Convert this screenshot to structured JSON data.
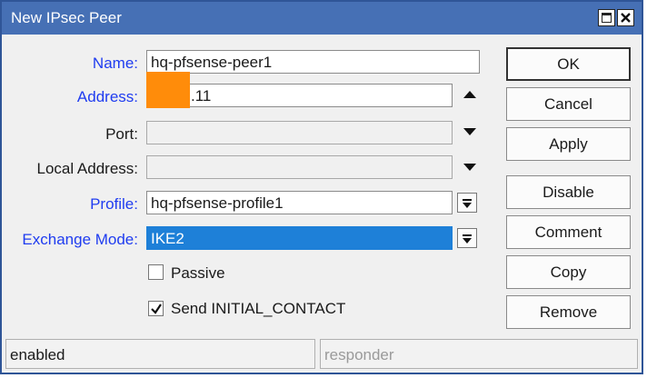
{
  "window": {
    "title": "New IPsec Peer"
  },
  "form": {
    "name": {
      "label": "Name:",
      "value": "hq-pfsense-peer1"
    },
    "address": {
      "label": "Address:",
      "value": ".11"
    },
    "port": {
      "label": "Port:",
      "value": ""
    },
    "local_address": {
      "label": "Local Address:",
      "value": ""
    },
    "profile": {
      "label": "Profile:",
      "value": "hq-pfsense-profile1"
    },
    "exchange_mode": {
      "label": "Exchange Mode:",
      "value": "IKE2"
    },
    "passive": {
      "label": "Passive",
      "checked": false
    },
    "send_initial_contact": {
      "label": "Send INITIAL_CONTACT",
      "checked": true
    }
  },
  "buttons": {
    "ok": "OK",
    "cancel": "Cancel",
    "apply": "Apply",
    "disable": "Disable",
    "comment": "Comment",
    "copy": "Copy",
    "remove": "Remove"
  },
  "status_bar": {
    "left": "enabled",
    "right": "responder"
  },
  "colors": {
    "titlebar": "#4670b5",
    "label_blue": "#1f3cf0",
    "selection": "#1e80d8",
    "redaction": "#ff8c0a"
  }
}
